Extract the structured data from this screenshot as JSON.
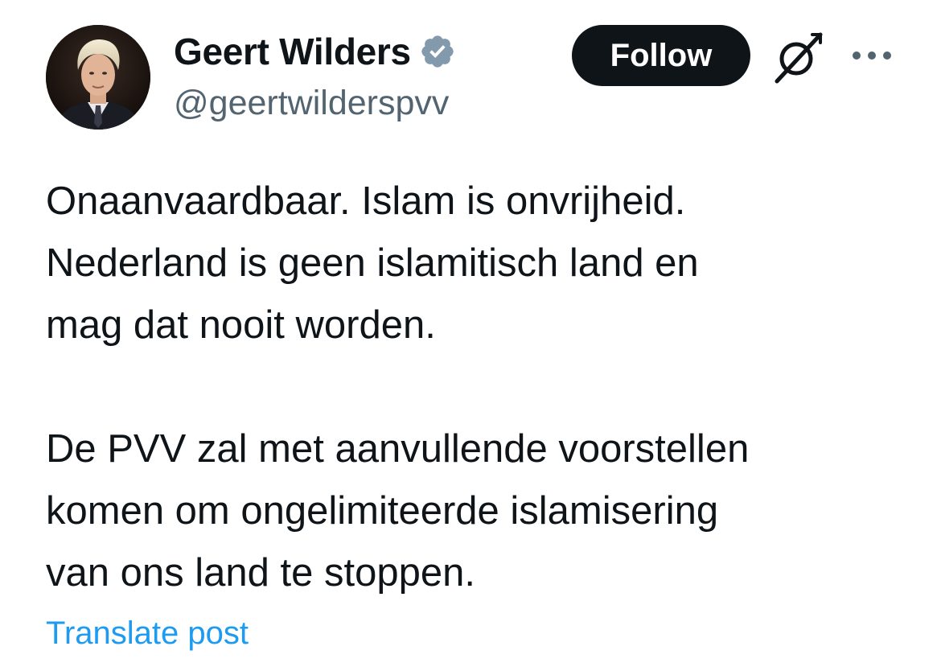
{
  "author": {
    "display_name": "Geert Wilders",
    "handle": "@geertwilderspvv",
    "verified": true,
    "avatar_icon": "profile-photo"
  },
  "actions": {
    "follow_label": "Follow",
    "grok_icon": "grok-icon",
    "more_icon": "more-options-icon"
  },
  "post": {
    "paragraphs": [
      "Onaanvaardbaar. Islam is onvrijheid.\nNederland is geen islamitisch land en\nmag dat nooit worden.",
      "De PVV zal met aanvullende voorstellen\nkomen om ongelimiteerde islamisering\nvan ons land te stoppen."
    ],
    "translate_label": "Translate post"
  },
  "colors": {
    "text": "#0f1419",
    "secondary_text": "#536471",
    "link": "#1d9bf0",
    "follow_button_bg": "#0f1419",
    "verified_badge": "#829aab"
  }
}
